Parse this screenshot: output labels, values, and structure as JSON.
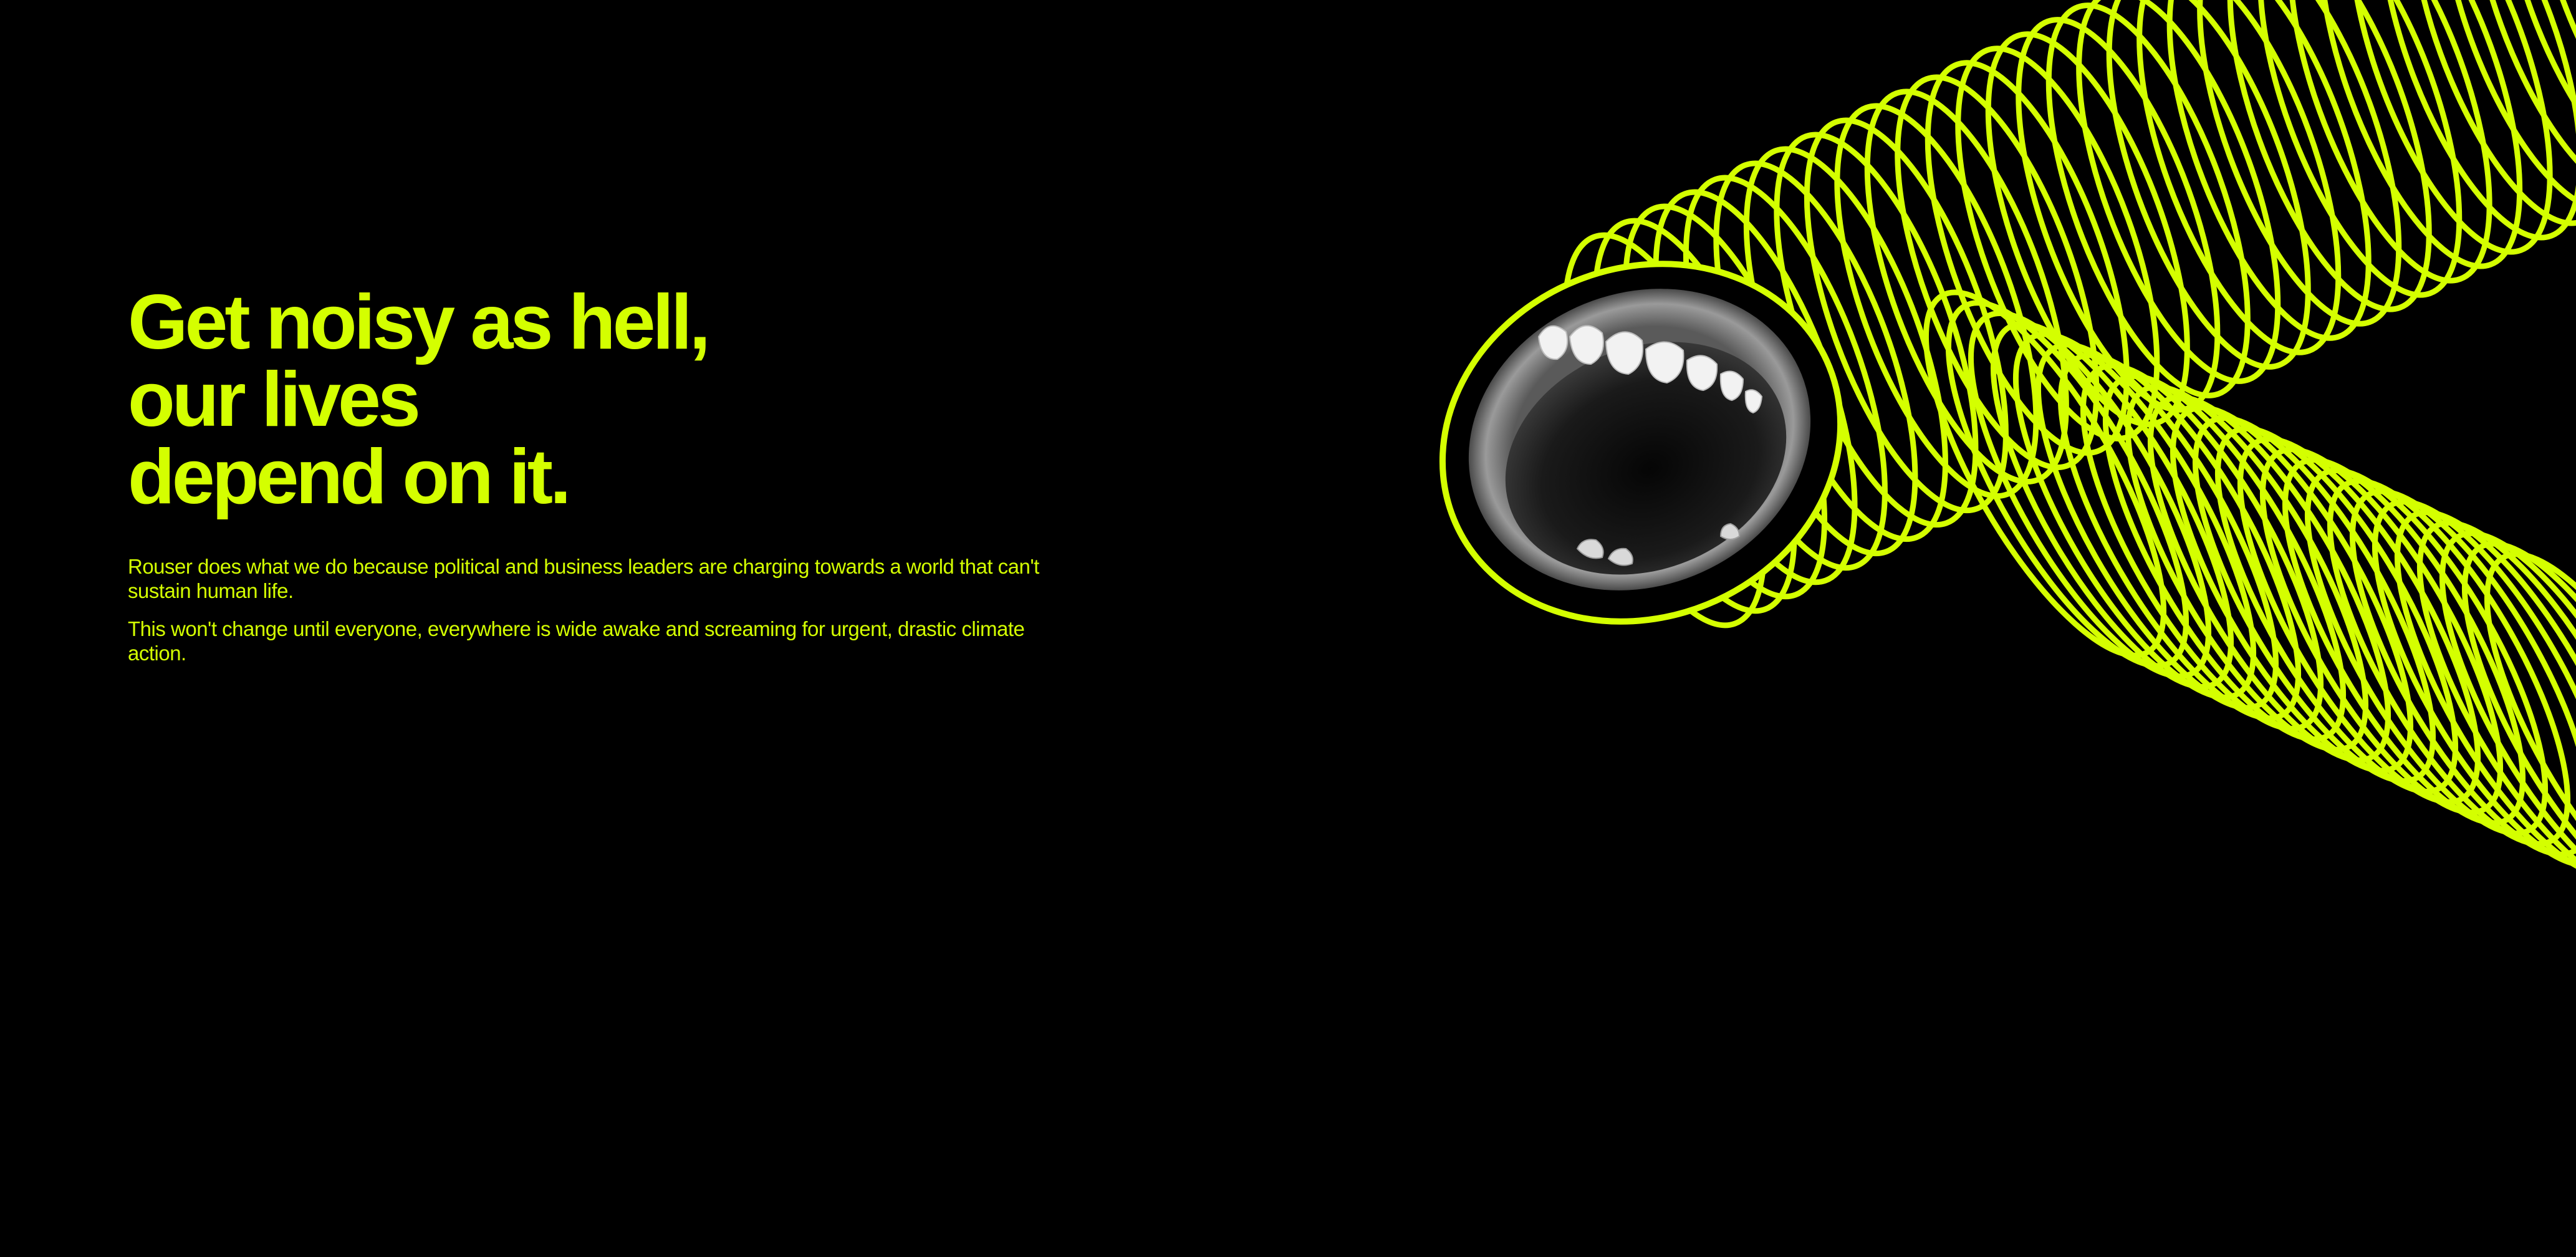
{
  "hero": {
    "headline": [
      "Get noisy as hell,",
      "our lives",
      "depend on it."
    ],
    "paragraphs": [
      "Rouser does what we do because political and business leaders are charging towards a world that can't sustain human life.",
      "This won't change until everyone, everywhere is wide awake and screaming for urgent, drastic climate action."
    ]
  },
  "theme": {
    "background": "#000000",
    "accent": "#d4ff00"
  },
  "illustration": {
    "subject": "screaming-mouth-with-coiled-sound-tube",
    "icon": "mouth-icon"
  }
}
